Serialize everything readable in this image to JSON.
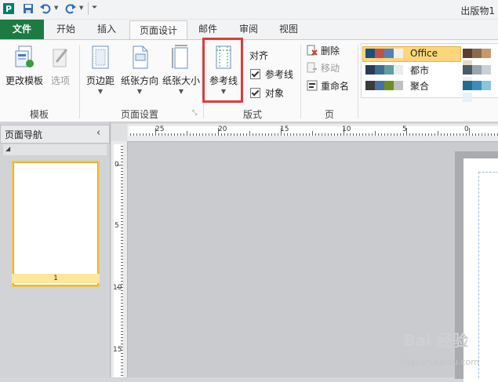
{
  "app": {
    "title": "出版物1"
  },
  "qat": {
    "save_icon": "save-icon",
    "undo_icon": "undo-icon",
    "redo_icon": "redo-icon"
  },
  "tabs": [
    {
      "label": "文件"
    },
    {
      "label": "开始"
    },
    {
      "label": "插入"
    },
    {
      "label": "页面设计"
    },
    {
      "label": "邮件"
    },
    {
      "label": "审阅"
    },
    {
      "label": "视图"
    }
  ],
  "ribbon": {
    "template_group": {
      "label": "模板",
      "change_template": "更改模板",
      "options": "选项"
    },
    "page_setup_group": {
      "label": "页面设置",
      "margins": "页边距",
      "orientation": "纸张方向",
      "size": "纸张大小"
    },
    "layout_group": {
      "label": "版式",
      "guides": "参考线",
      "align": "对齐",
      "guides_check": "参考线",
      "objects_check": "对象"
    },
    "page_group": {
      "label": "页",
      "delete": "删除",
      "move": "移动",
      "rename": "重命名"
    },
    "schemes": [
      {
        "name": "Office",
        "colors": [
          "#1f4e79",
          "#c0504d",
          "#4f81bd",
          "#9bbb59",
          "#f0f0f0"
        ]
      },
      {
        "name": "都市",
        "colors": [
          "#2b3a55",
          "#3e6e8e",
          "#5f9ea0",
          "#8fb8c9",
          "#eaeaea"
        ]
      },
      {
        "name": "聚合",
        "colors": [
          "#3b3b3b",
          "#4a6fa5",
          "#6b8e23",
          "#c0c0c0",
          "#f5f5f5"
        ]
      }
    ]
  },
  "nav": {
    "title": "页面导航",
    "collapse": "‹",
    "page_number": "1"
  },
  "ruler": {
    "h_labels": [
      "25",
      "20",
      "15",
      "10",
      "5",
      "0"
    ],
    "v_labels": [
      "0",
      "5",
      "10",
      "15"
    ]
  },
  "watermark": {
    "text": "Bai 经验",
    "url": "jingyan.baidu.com"
  }
}
